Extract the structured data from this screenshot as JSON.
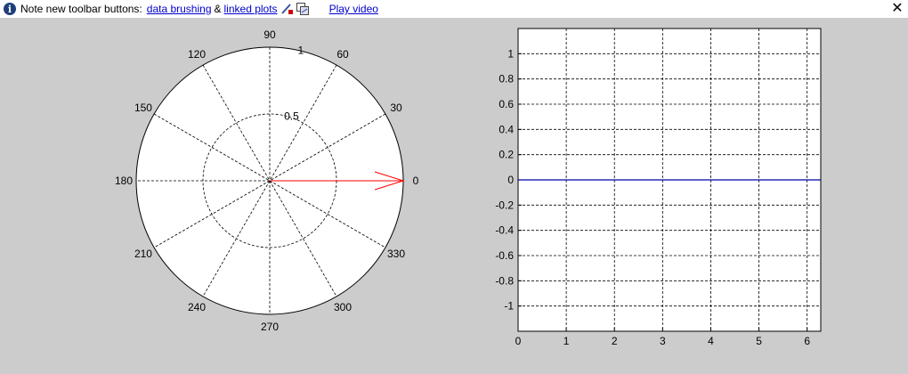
{
  "infobar": {
    "icon": "info-icon",
    "note_text": "Note new toolbar buttons:",
    "link_brushing": "data brushing",
    "ampersand": "&",
    "link_linked": "linked plots",
    "brush_icon": "brush-icon",
    "link_icon": "linked-plots-icon",
    "play_video": "Play video",
    "close_icon": "close-icon",
    "close_glyph": "✕"
  },
  "chart_data": [
    {
      "type": "polar",
      "angle_ticks": [
        "0",
        "30",
        "60",
        "90",
        "120",
        "150",
        "180",
        "210",
        "240",
        "270",
        "300",
        "330"
      ],
      "radial_ticks": [
        "0.5",
        "1"
      ],
      "rlim": [
        0,
        1
      ],
      "grid": true,
      "series": [
        {
          "type": "compass-arrow",
          "theta_deg": 0,
          "r": 1,
          "color": "#ff0000"
        }
      ]
    },
    {
      "type": "line",
      "xlim": [
        0,
        6.2832
      ],
      "ylim": [
        -1.2,
        1.2
      ],
      "xticks": [
        "0",
        "1",
        "2",
        "3",
        "4",
        "5",
        "6"
      ],
      "yticks": [
        "-1",
        "-0.8",
        "-0.6",
        "-0.4",
        "-0.2",
        "0",
        "0.2",
        "0.4",
        "0.6",
        "0.8",
        "1"
      ],
      "grid": true,
      "series": [
        {
          "x": [
            0,
            6.2832
          ],
          "y": [
            0,
            0
          ],
          "color": "#0000aa"
        }
      ]
    }
  ]
}
